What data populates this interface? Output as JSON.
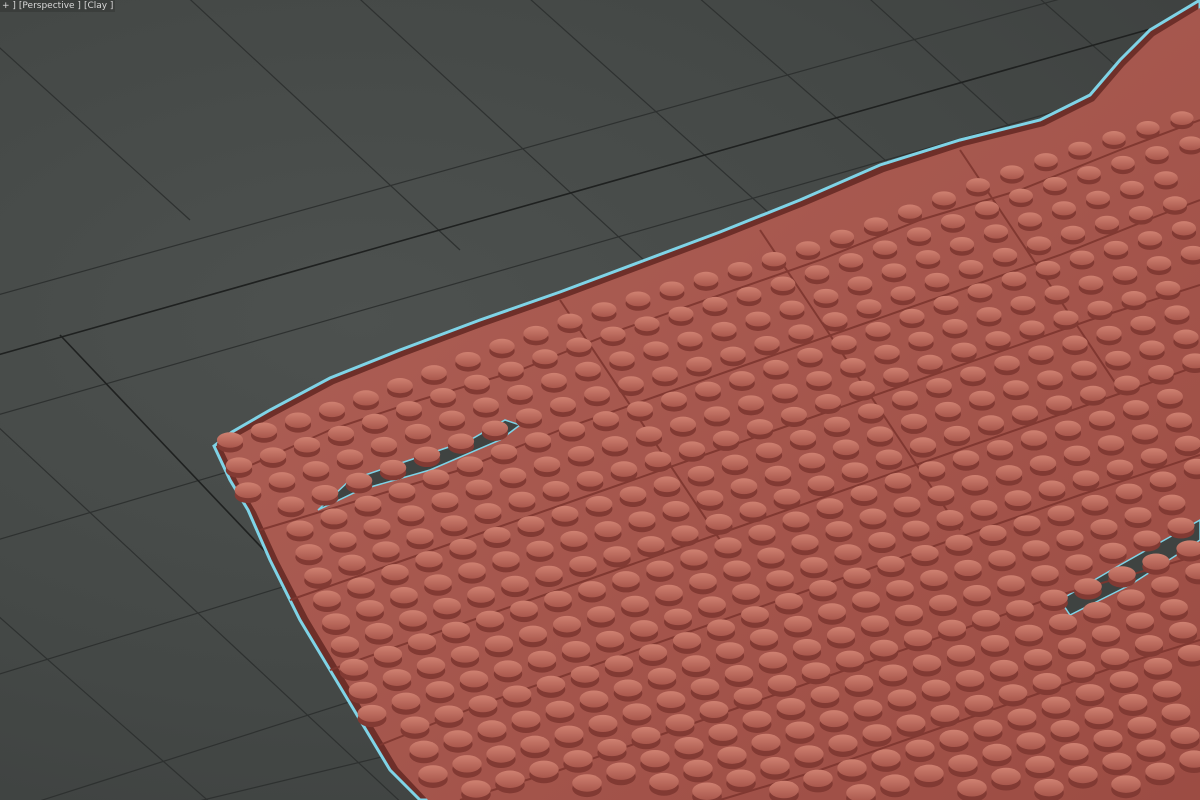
{
  "viewport": {
    "labels": {
      "menu": "+ ]",
      "view": "[Perspective ]",
      "shading": "[Clay ]"
    },
    "colors": {
      "background": "#454947",
      "grid_line": "#2c2f2e",
      "grid_major": "#202221",
      "brick_top": "#b86a60",
      "brick_side": "#8a4038",
      "brick_stud": "#c97868",
      "selection_outline": "#7fd3e6"
    }
  }
}
